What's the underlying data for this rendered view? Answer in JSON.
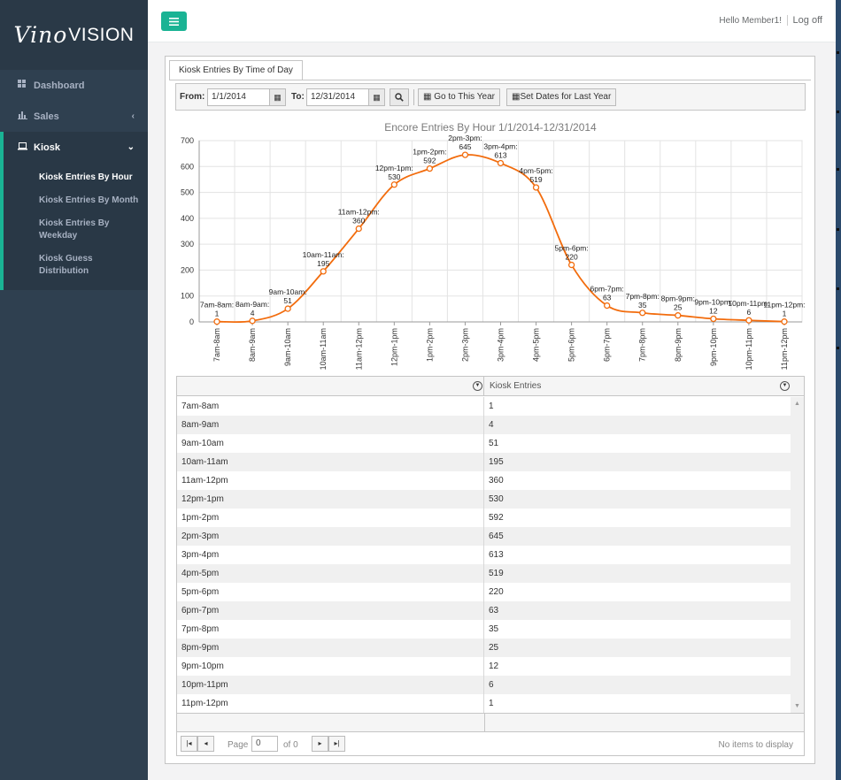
{
  "brand": {
    "vino": "Vino",
    "vision": "VISION"
  },
  "sidebar": {
    "items": [
      {
        "label": "Dashboard",
        "icon": "grid-icon"
      },
      {
        "label": "Sales",
        "icon": "bar-chart-icon"
      },
      {
        "label": "Kiosk",
        "icon": "laptop-icon"
      }
    ],
    "kiosk_sub": [
      "Kiosk Entries By Hour",
      "Kiosk Entries By Month",
      "Kiosk Entries By Weekday",
      "Kiosk Guess Distribution"
    ]
  },
  "topbar": {
    "greeting": "Hello Member1!",
    "logoff": "Log off"
  },
  "tab": {
    "label": "Kiosk Entries By Time of Day"
  },
  "toolbar": {
    "from_label": "From:",
    "from_value": "1/1/2014",
    "to_label": "To:",
    "to_value": "12/31/2014",
    "this_year": "Go to This Year",
    "last_year": "Set Dates for Last Year"
  },
  "chart_data": {
    "type": "line",
    "title": "Encore Entries By Hour 1/1/2014-12/31/2014",
    "categories": [
      "7am-8am",
      "8am-9am",
      "9am-10am",
      "10am-11am",
      "11am-12pm",
      "12pm-1pm",
      "1pm-2pm",
      "2pm-3pm",
      "3pm-4pm",
      "4pm-5pm",
      "5pm-6pm",
      "6pm-7pm",
      "7pm-8pm",
      "8pm-9pm",
      "9pm-10pm",
      "10pm-11pm",
      "11pm-12pm"
    ],
    "values": [
      1,
      4,
      51,
      195,
      360,
      530,
      592,
      645,
      613,
      519,
      220,
      63,
      35,
      25,
      12,
      6,
      1
    ],
    "ylim": [
      0,
      700
    ],
    "yticks": [
      0,
      100,
      200,
      300,
      400,
      500,
      600,
      700
    ],
    "line_color": "#f26c0d",
    "grid": true
  },
  "grid": {
    "columns": [
      "",
      "Kiosk Entries"
    ],
    "rows": [
      [
        "7am-8am",
        "1"
      ],
      [
        "8am-9am",
        "4"
      ],
      [
        "9am-10am",
        "51"
      ],
      [
        "10am-11am",
        "195"
      ],
      [
        "11am-12pm",
        "360"
      ],
      [
        "12pm-1pm",
        "530"
      ],
      [
        "1pm-2pm",
        "592"
      ],
      [
        "2pm-3pm",
        "645"
      ],
      [
        "3pm-4pm",
        "613"
      ],
      [
        "4pm-5pm",
        "519"
      ],
      [
        "5pm-6pm",
        "220"
      ],
      [
        "6pm-7pm",
        "63"
      ],
      [
        "7pm-8pm",
        "35"
      ],
      [
        "8pm-9pm",
        "25"
      ],
      [
        "9pm-10pm",
        "12"
      ],
      [
        "10pm-11pm",
        "6"
      ],
      [
        "11pm-12pm",
        "1"
      ]
    ]
  },
  "pager": {
    "page_label": "Page",
    "page_value": "0",
    "of_label": "of 0",
    "empty": "No items to display"
  },
  "colors": {
    "accent": "#1ab394",
    "sidebar": "#2f4050"
  }
}
